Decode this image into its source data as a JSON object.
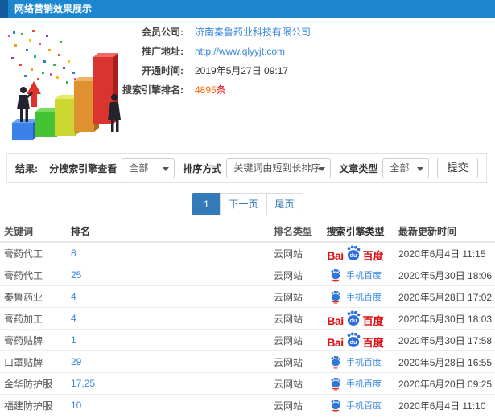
{
  "header": {
    "title": "网络营销效果展示"
  },
  "info": {
    "rows": [
      {
        "label": "会员公司:",
        "value": "济南秦鲁药业科技有限公司"
      },
      {
        "label": "推广地址:",
        "value": "http://www.qlyyjt.com"
      },
      {
        "label": "开通时间:",
        "value": "2019年5月27日 09:17"
      },
      {
        "label": "搜索引擎排名:",
        "value_number": "4895",
        "value_unit": "条"
      }
    ]
  },
  "filters": {
    "section_label": "结果:",
    "engine_label": "分搜索引擎查看",
    "engine_value": "全部",
    "sort_label": "排序方式",
    "sort_value": "关键词由短到长排序",
    "article_label": "文章类型",
    "article_value": "全部",
    "submit_label": "提交"
  },
  "pagination": {
    "current": "1",
    "next_label": "下一页",
    "last_label": "尾页"
  },
  "table": {
    "headers": [
      "关键词",
      "排名",
      "排名类型",
      "搜索引擎类型",
      "最新更新时间"
    ],
    "baidu_logo": {
      "bai": "Bai",
      "du": "du",
      "cn": "百度"
    },
    "mobile_baidu_label": "手机百度",
    "rows": [
      {
        "keyword": "膏药代工",
        "rank": "8",
        "rank_type": "云网站",
        "engine": "百度",
        "updated": "2020年6月4日 11:15"
      },
      {
        "keyword": "膏药代工",
        "rank": "25",
        "rank_type": "云网站",
        "engine": "手机百度",
        "updated": "2020年5月30日 18:06"
      },
      {
        "keyword": "秦鲁药业",
        "rank": "4",
        "rank_type": "云网站",
        "engine": "手机百度",
        "updated": "2020年5月28日 17:02"
      },
      {
        "keyword": "膏药加工",
        "rank": "4",
        "rank_type": "云网站",
        "engine": "百度",
        "updated": "2020年5月30日 18:03"
      },
      {
        "keyword": "膏药贴牌",
        "rank": "1",
        "rank_type": "云网站",
        "engine": "百度",
        "updated": "2020年5月30日 17:58"
      },
      {
        "keyword": "口罩贴牌",
        "rank": "29",
        "rank_type": "云网站",
        "engine": "手机百度",
        "updated": "2020年5月28日 16:55"
      },
      {
        "keyword": "金华防护服",
        "rank": "17,25",
        "rank_type": "云网站",
        "engine": "手机百度",
        "updated": "2020年6月20日 09:25"
      },
      {
        "keyword": "福建防护服",
        "rank": "10",
        "rank_type": "云网站",
        "engine": "手机百度",
        "updated": "2020年6月4日 11:10"
      }
    ]
  },
  "colors": {
    "header_bg": "#1c86d1",
    "header_accent": "#125c9b",
    "link_blue": "#3a87d9",
    "count_orange": "#ff6600",
    "count_red": "#e60012",
    "baidu_red": "#de0b10",
    "baidu_blue": "#2c6de0",
    "pager_active": "#337ab7"
  }
}
